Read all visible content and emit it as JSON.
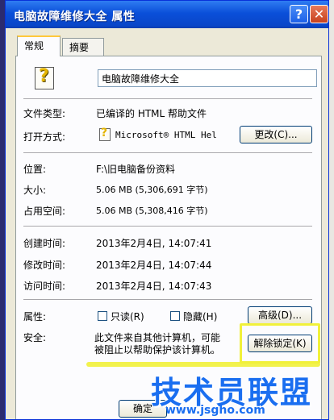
{
  "window": {
    "title": "电脑故障维修大全 属性",
    "help_glyph": "?",
    "close_glyph": "✕"
  },
  "tabs": [
    {
      "label": "常规"
    },
    {
      "label": "摘要"
    }
  ],
  "file": {
    "name": "电脑故障维修大全",
    "icon": "chm-file-icon"
  },
  "labels": {
    "type": "文件类型:",
    "open_with": "打开方式:",
    "location": "位置:",
    "size": "大小:",
    "size_on_disk": "占用空间:",
    "created": "创建时间:",
    "modified": "修改时间:",
    "accessed": "访问时间:",
    "attributes": "属性:",
    "security": "安全:"
  },
  "values": {
    "type": "已编译的 HTML 帮助文件",
    "open_with": "Microsoft® HTML Hel",
    "location": "F:\\旧电脑备份资料",
    "size": "5.06 MB (5,306,691 字节)",
    "size_on_disk": "5.06 MB (5,308,416 字节)",
    "created": "2013年2月4日, 14:07:41",
    "modified": "2013年2月4日, 14:07:44",
    "accessed": "2013年2月4日, 14:07:43",
    "security_line1": "此文件来自其他计算机，可能",
    "security_line2": "被阻止以帮助保护该计算机。"
  },
  "buttons": {
    "change": "更改(C)...",
    "advanced": "高级(D)...",
    "unblock": "解除锁定(K)",
    "ok": "确定"
  },
  "checkboxes": {
    "readonly": {
      "label": "只读(R)",
      "checked": false
    },
    "hidden": {
      "label": "隐藏(H)",
      "checked": false
    }
  },
  "watermark": {
    "text": "技术员联盟",
    "url": "www.jsgho.com"
  }
}
